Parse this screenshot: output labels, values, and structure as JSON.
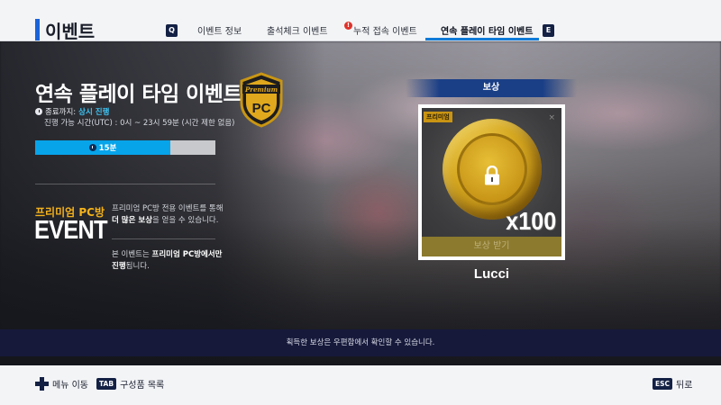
{
  "header": {
    "title": "이벤트",
    "prev_key": "Q",
    "next_key": "E",
    "tabs": [
      {
        "label": "이벤트 정보"
      },
      {
        "label": "출석체크 이벤트"
      },
      {
        "label": "누적 접속 이벤트",
        "alert": "!"
      },
      {
        "label": "연속 플레이 타임 이벤트",
        "active": true
      }
    ]
  },
  "event": {
    "title": "연속 플레이 타임 이벤트",
    "end_label": "종료까지:",
    "end_value": "상시 진행",
    "hours": "진행 가능 시간(UTC) : 0시 ~ 23시 59분 (시간 제한 없음)",
    "progress_label": "15분",
    "progress_fraction": 0.75,
    "premium_label": "프리미엄 PC방",
    "event_word": "EVENT",
    "desc1_pre": "프리미엄 PC방 전용 이벤트를 통해",
    "desc1_bold": "더 많은 보상",
    "desc1_post": "을 얻을 수 있습니다.",
    "desc2_pre": "본 이벤트는",
    "desc2_bold": "프리미엄 PC방에서만",
    "desc2_bold2": "진행",
    "desc2_post": "됩니다."
  },
  "badge": {
    "top_text": "Premium",
    "main_text": "PC"
  },
  "reward": {
    "header": "보상",
    "tag": "프리미엄",
    "close_glyph": "×",
    "icon": "lock-icon",
    "quantity": "x100",
    "claim_label": "보상 받기",
    "name": "Lucci"
  },
  "info": {
    "text": "획득한 보상은 우편함에서 확인할 수 있습니다."
  },
  "footer": {
    "menu_label": "메뉴 이동",
    "tab_key": "TAB",
    "tab_label": "구성품 목록",
    "esc_key": "ESC",
    "back_label": "뒤로"
  },
  "colors": {
    "accent": "#0f7bd8",
    "highlight": "#3fc4f3",
    "premium": "#f5b21a",
    "progress": "#07a4ea",
    "strip": "#16193a"
  }
}
